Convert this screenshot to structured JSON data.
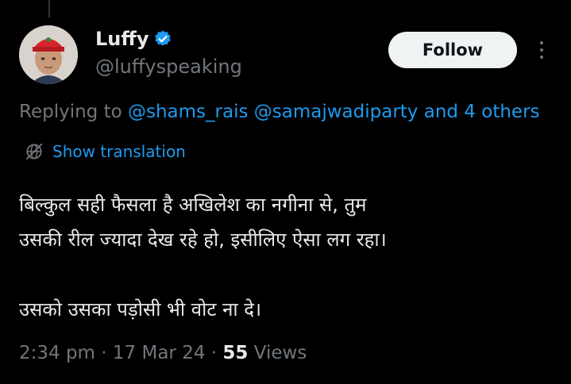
{
  "author": {
    "name": "Luffy",
    "handle": "@luffyspeaking",
    "verified": true
  },
  "actions": {
    "follow_label": "Follow",
    "more_icon": "more-vertical-icon"
  },
  "reply_context": {
    "prefix": "Replying to",
    "mention_1": "@shams_rais",
    "mention_2": "@samajwadiparty",
    "suffix": "and 4 others"
  },
  "translate": {
    "label": "Show translation",
    "icon": "globe-icon"
  },
  "tweet": {
    "line_1": "बिल्कुल सही फैसला है अखिलेश का नगीना से, तुम",
    "line_2": "उसकी रील ज्यादा देख रहे हो, इसीलिए ऐसा लग रहा।",
    "line_3": "उसको उसका पड़ोसी भी वोट ना दे।"
  },
  "meta": {
    "time": "2:34 pm",
    "separator": "·",
    "date": "17 Mar 24",
    "views_count": "55",
    "views_label": "Views"
  },
  "colors": {
    "background": "#000000",
    "text": "#e7e9ea",
    "secondary": "#71767b",
    "link": "#1d9bf0",
    "verified": "#1d9bf0",
    "follow_bg": "#eff3f4",
    "avatar_cap": "#d8232a"
  }
}
